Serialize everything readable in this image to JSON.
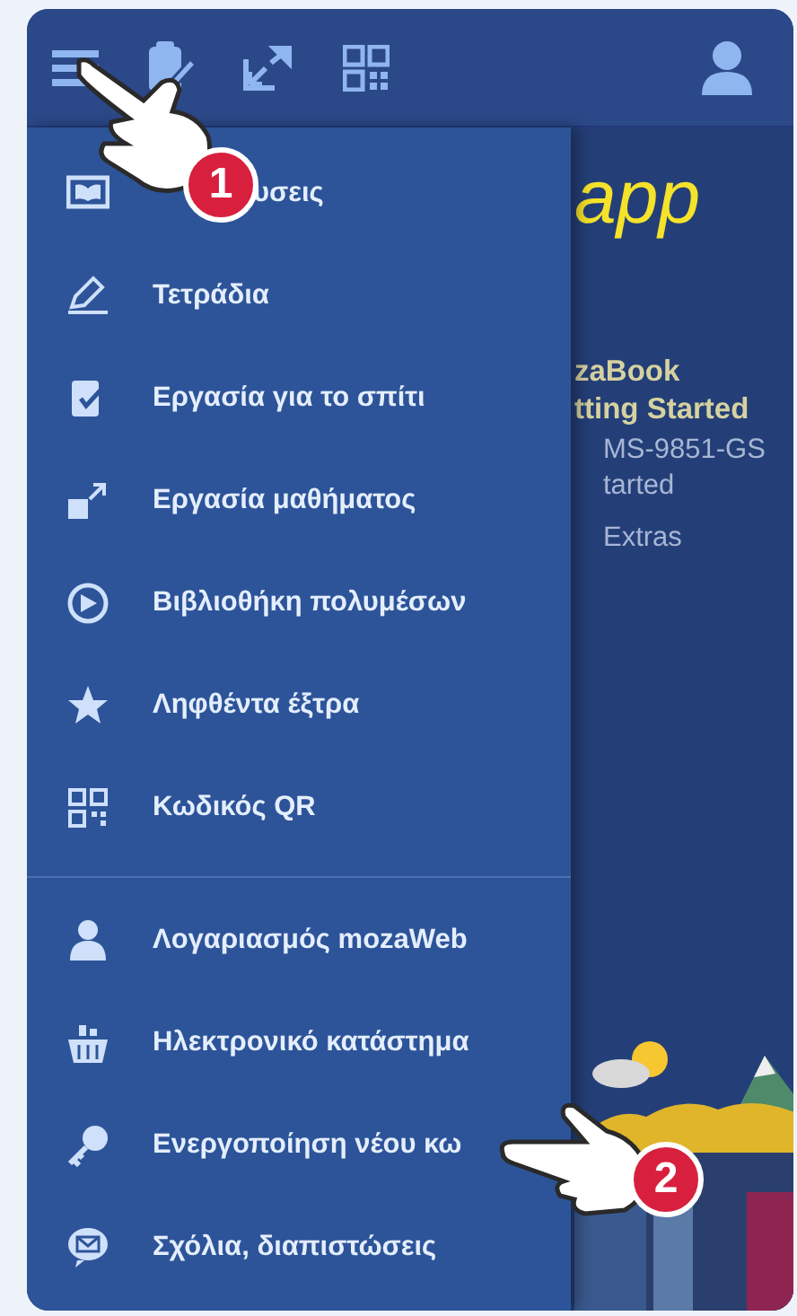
{
  "menu": {
    "sections": [
      {
        "items": [
          {
            "label": "υσεις"
          },
          {
            "label": "Τετράδια"
          },
          {
            "label": "Εργασία για το σπίτι"
          },
          {
            "label": "Εργασία μαθήματος"
          },
          {
            "label": "Βιβλιοθήκη πολυμέσων"
          },
          {
            "label": "Ληφθέντα έξτρα"
          },
          {
            "label": "Κωδικός QR"
          }
        ]
      },
      {
        "items": [
          {
            "label": "Λογαριασμός mozaWeb"
          },
          {
            "label": "Ηλεκτρονικό κατάστημα"
          },
          {
            "label": "Ενεργοποίηση νέου κω"
          },
          {
            "label": "Σχόλια, διαπιστώσεις"
          }
        ]
      }
    ]
  },
  "content": {
    "logo": "app",
    "title_lines": [
      "zaBook",
      "tting Started"
    ],
    "lines": [
      "MS-9851-GS",
      "tarted"
    ],
    "extras": "Extras"
  },
  "callouts": [
    {
      "number": "1"
    },
    {
      "number": "2"
    }
  ]
}
